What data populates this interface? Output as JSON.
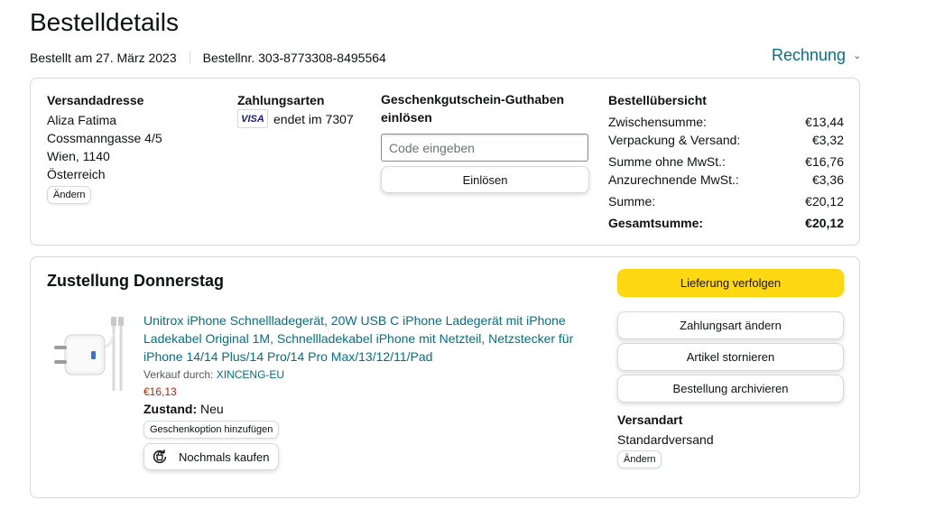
{
  "page": {
    "title": "Bestelldetails",
    "ordered_on": "Bestellt am 27. März 2023",
    "order_number": "Bestellnr. 303-8773308-8495564",
    "invoice_label": "Rechnung"
  },
  "shipping_address": {
    "heading": "Versandadresse",
    "name": "Aliza Fatima",
    "street": "Cossmanngasse 4/5",
    "city": "Wien, 1140",
    "country": "Österreich",
    "change_label": "Ändern"
  },
  "payment": {
    "heading": "Zahlungsarten",
    "card_brand": "VISA",
    "card_text": "endet im 7307"
  },
  "gift_card": {
    "heading": "Geschenkgutschein-Guthaben einlösen",
    "placeholder": "Code eingeben",
    "redeem_label": "Einlösen"
  },
  "order_summary": {
    "heading": "Bestellübersicht",
    "rows": [
      {
        "label": "Zwischensumme:",
        "value": "€13,44"
      },
      {
        "label": "Verpackung & Versand:",
        "value": "€3,32"
      },
      {
        "label": "Summe ohne MwSt.:",
        "value": "€16,76"
      },
      {
        "label": "Anzurechnende MwSt.:",
        "value": "€3,36"
      },
      {
        "label": "Summe:",
        "value": "€20,12"
      }
    ],
    "total_label": "Gesamtsumme:",
    "total_value": "€20,12"
  },
  "delivery": {
    "title": "Zustellung Donnerstag",
    "product": {
      "title": "Unitrox iPhone Schnellladegerät, 20W USB C iPhone Ladegerät mit iPhone Ladekabel Original 1M, Schnellladekabel iPhone mit Netzteil, Netzstecker für iPhone 14/14 Plus/14 Pro/14 Pro Max/13/12/11/Pad",
      "sold_by_label": "Verkauf durch:",
      "seller": "XINCENG-EU",
      "price": "€16,13",
      "condition_label": "Zustand:",
      "condition_value": "Neu",
      "gift_option_label": "Geschenkoption hinzufügen",
      "buy_again_label": "Nochmals kaufen"
    },
    "actions": {
      "track": "Lieferung verfolgen",
      "change_payment": "Zahlungsart ändern",
      "cancel_items": "Artikel stornieren",
      "archive_order": "Bestellung archivieren"
    },
    "shipping_method": {
      "heading": "Versandart",
      "value": "Standardversand",
      "change_label": "Ändern"
    }
  },
  "colors": {
    "link": "#007185",
    "price": "#B12704",
    "primary_button": "#FFD814",
    "border": "#D5D9D9"
  }
}
